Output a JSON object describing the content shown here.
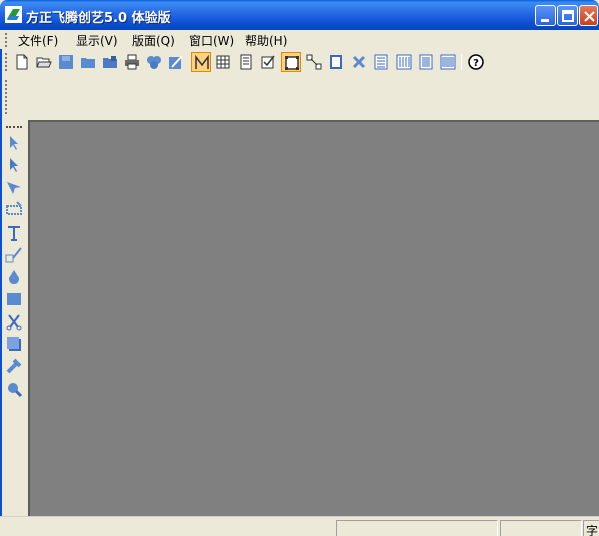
{
  "window": {
    "title": "方正飞腾创艺5.0 体验版"
  },
  "menubar": {
    "items": [
      {
        "label": "文件(F)"
      },
      {
        "label": "显示(V)"
      },
      {
        "label": "版面(Q)"
      },
      {
        "label": "窗口(W)"
      },
      {
        "label": "帮助(H)"
      }
    ]
  },
  "toolbar": {
    "buttons": [
      {
        "icon": "new-document-icon"
      },
      {
        "icon": "open-folder-icon"
      },
      {
        "icon": "save-icon"
      },
      {
        "icon": "folder-icon"
      },
      {
        "icon": "folder-save-icon"
      },
      {
        "icon": "print-icon"
      },
      {
        "icon": "group-icon"
      },
      {
        "icon": "image-edit-icon"
      },
      {
        "icon": "marker-toggle-icon",
        "active": true
      },
      {
        "icon": "grid-icon"
      },
      {
        "icon": "page-icon"
      },
      {
        "icon": "checkbox-icon"
      },
      {
        "icon": "frame-toggle-icon",
        "active": true
      },
      {
        "icon": "connect-icon"
      },
      {
        "icon": "rect-frame-icon"
      },
      {
        "icon": "delete-link-icon"
      },
      {
        "icon": "text-page-icon"
      },
      {
        "icon": "columns-icon"
      },
      {
        "icon": "text-block-icon"
      },
      {
        "icon": "vertical-columns-icon"
      },
      {
        "icon": "help-icon"
      }
    ]
  },
  "palette": {
    "tools": [
      {
        "icon": "select-arrow-icon"
      },
      {
        "icon": "direct-select-icon"
      },
      {
        "icon": "rotate-icon"
      },
      {
        "icon": "crop-icon"
      },
      {
        "icon": "text-tool-icon"
      },
      {
        "icon": "pen-tool-icon"
      },
      {
        "icon": "fill-icon"
      },
      {
        "icon": "rectangle-icon"
      },
      {
        "icon": "scissors-icon"
      },
      {
        "icon": "shadow-icon"
      },
      {
        "icon": "eyedropper-icon"
      },
      {
        "icon": "zoom-icon"
      }
    ]
  },
  "statusbar": {
    "last_pane_text": "字"
  },
  "colors": {
    "titlebar": "#0A4FD0",
    "canvas": "#808080",
    "chrome": "#ECE9D8",
    "active_button": "#FFD280"
  }
}
